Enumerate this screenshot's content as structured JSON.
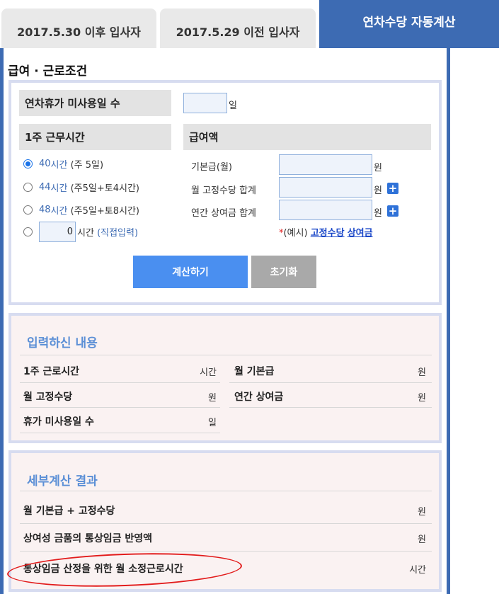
{
  "tabs": [
    {
      "label": "2017.5.30 이후 입사자",
      "active": false
    },
    {
      "label": "2017.5.29 이전 입사자",
      "active": false
    },
    {
      "label": "연차수당 자동계산",
      "active": true
    }
  ],
  "section_title": "급여 · 근로조건",
  "unused_leave": {
    "label": "연차휴가 미사용일 수",
    "value": "",
    "unit": "일"
  },
  "weekly_hours": {
    "label": "1주 근무시간",
    "options": [
      {
        "hours": "40",
        "unit_text": "시간",
        "desc": "(주 5일)",
        "checked": true
      },
      {
        "hours": "44",
        "unit_text": "시간",
        "desc": "(주5일+토4시간)",
        "checked": false
      },
      {
        "hours": "48",
        "unit_text": "시간",
        "desc": "(주5일+토8시간)",
        "checked": false
      }
    ],
    "custom": {
      "value": "0",
      "unit_text": "시간",
      "desc": "(직접입력)",
      "checked": false
    }
  },
  "salary": {
    "label": "급여액",
    "base": {
      "label": "기본급(월)",
      "value": "",
      "unit": "원"
    },
    "fixed": {
      "label": "월 고정수당 합계",
      "value": "",
      "unit": "원"
    },
    "bonus": {
      "label": "연간 상여금 합계",
      "value": "",
      "unit": "원"
    },
    "example": {
      "asterisk": "*",
      "prefix": "(예시)",
      "link1": "고정수당",
      "link2": "상여금"
    }
  },
  "buttons": {
    "calculate": "계산하기",
    "reset": "초기화"
  },
  "entered": {
    "title": "입력하신 내용",
    "rows": [
      {
        "label": "1주 근로시간",
        "unit": "시간"
      },
      {
        "label": "월 기본급",
        "unit": "원"
      },
      {
        "label": "월 고정수당",
        "unit": "원"
      },
      {
        "label": "연간 상여금",
        "unit": "원"
      },
      {
        "label": "휴가 미사용일 수",
        "unit": "일"
      }
    ]
  },
  "detail": {
    "title": "세부계산 결과",
    "rows": [
      {
        "label": "월 기본급 + 고정수당",
        "unit": "원"
      },
      {
        "label": "상여성 금품의 통상임금 반영액",
        "unit": "원"
      },
      {
        "label": "통상임금 산정을 위한 월 소정근로시간",
        "unit": "시간"
      }
    ]
  },
  "colors": {
    "accent": "#3d6bb3",
    "calc_button": "#4a8ff0",
    "reset_button": "#a9a9a9",
    "annotation": "#e21b1b"
  }
}
